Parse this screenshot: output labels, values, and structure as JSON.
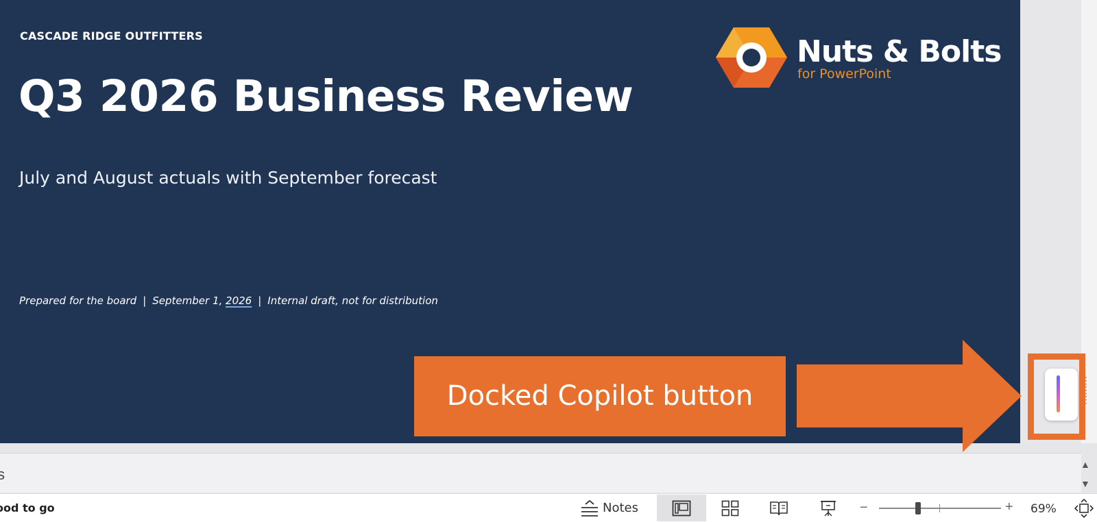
{
  "slide": {
    "company": "CASCADE RIDGE OUTFITTERS",
    "title": "Q3 2026 Business Review",
    "subtitle": "July and August actuals with September forecast",
    "footer": {
      "part1": "Prepared for the board",
      "separator": "|",
      "part2_prefix": "September 1, ",
      "part2_year": "2026",
      "part3": "Internal draft, not for distribution"
    },
    "background_color": "#203453"
  },
  "logo": {
    "name": "Nuts & Bolts",
    "tagline": "for PowerPoint",
    "accent_color": "#f0901e"
  },
  "callout": {
    "text": "Docked Copilot button",
    "color": "#e8702e"
  },
  "copilot": {
    "icon": "copilot-icon"
  },
  "notes_pane": {
    "hint": "s"
  },
  "status_bar": {
    "status_text": "ood to go",
    "notes_label": "Notes",
    "zoom_minus": "−",
    "zoom_plus": "+",
    "zoom_level": "69%",
    "zoom_fraction": 0.32,
    "icons": [
      "normal-view-icon",
      "slide-sorter-icon",
      "reading-view-icon",
      "slideshow-icon",
      "fit-slide-icon"
    ]
  }
}
